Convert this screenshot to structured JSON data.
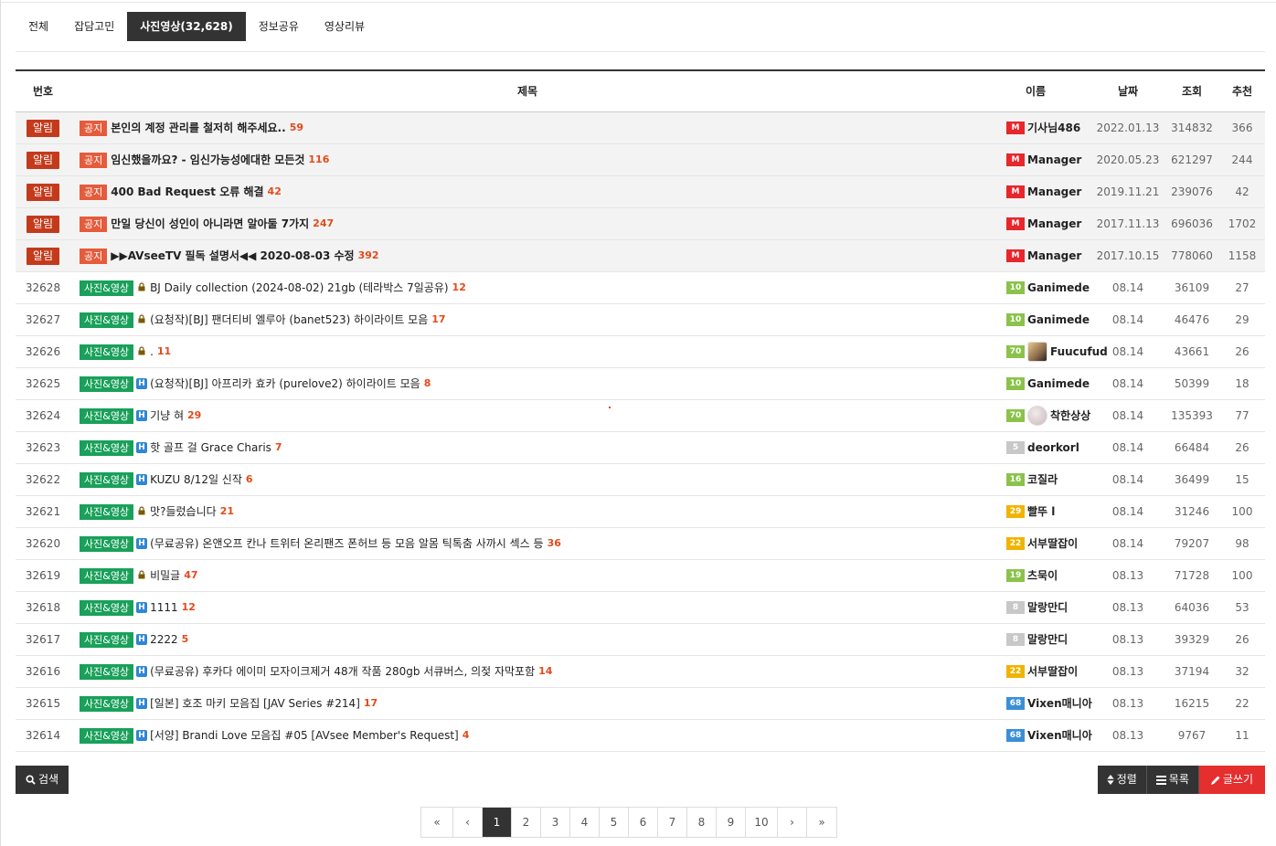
{
  "tabs": [
    {
      "label": "전체",
      "active": false
    },
    {
      "label": "잡담고민",
      "active": false
    },
    {
      "label": "사진영상(32,628)",
      "active": true
    },
    {
      "label": "정보공유",
      "active": false
    },
    {
      "label": "영상리뷰",
      "active": false
    }
  ],
  "headers": {
    "num": "번호",
    "subject": "제목",
    "name": "이름",
    "date": "날짜",
    "views": "조회",
    "rec": "추천"
  },
  "notices": [
    {
      "badge": "알림",
      "cat": "공지",
      "title": "본인의 계정 관리를 철저히 해주세요..",
      "comments": "59",
      "level": "M",
      "name": "기사님486",
      "date": "2022.01.13",
      "views": "314832",
      "rec": "366"
    },
    {
      "badge": "알림",
      "cat": "공지",
      "title": "임신했을까요? - 임신가능성에대한 모든것",
      "comments": "116",
      "level": "M",
      "name": "Manager",
      "date": "2020.05.23",
      "views": "621297",
      "rec": "244"
    },
    {
      "badge": "알림",
      "cat": "공지",
      "title": "400 Bad Request 오류 해결",
      "comments": "42",
      "level": "M",
      "name": "Manager",
      "date": "2019.11.21",
      "views": "239076",
      "rec": "42"
    },
    {
      "badge": "알림",
      "cat": "공지",
      "title": "만일 당신이 성인이 아니라면 알아둘 7가지",
      "comments": "247",
      "level": "M",
      "name": "Manager",
      "date": "2017.11.13",
      "views": "696036",
      "rec": "1702"
    },
    {
      "badge": "알림",
      "cat": "공지",
      "title": "▶▶AVseeTV 필독 설명서◀◀ 2020-08-03 수정",
      "comments": "392",
      "level": "M",
      "name": "Manager",
      "date": "2017.10.15",
      "views": "778060",
      "rec": "1158"
    }
  ],
  "posts": [
    {
      "num": "32628",
      "cat": "사진&영상",
      "icon": "lock",
      "title": "BJ Daily collection (2024-08-02) 21gb (테라박스 7일공유)",
      "comments": "12",
      "level": "10",
      "lvcolor": "#8bc34a",
      "avatar": "",
      "name": "Ganimede",
      "date": "08.14",
      "views": "36109",
      "rec": "27"
    },
    {
      "num": "32627",
      "cat": "사진&영상",
      "icon": "lock",
      "title": "(요청작)[BJ] 팬더티비 엘루아 (banet523) 하이라이트 모음",
      "comments": "17",
      "level": "10",
      "lvcolor": "#8bc34a",
      "avatar": "",
      "name": "Ganimede",
      "date": "08.14",
      "views": "46476",
      "rec": "29"
    },
    {
      "num": "32626",
      "cat": "사진&영상",
      "icon": "lock",
      "title": ".",
      "comments": "11",
      "level": "70",
      "lvcolor": "#8bc34a",
      "avatar": "blonde",
      "name": "Fuucufud",
      "date": "08.14",
      "views": "43661",
      "rec": "26"
    },
    {
      "num": "32625",
      "cat": "사진&영상",
      "icon": "hot",
      "title": "(요청작)[BJ] 아프리카 효카 (purelove2) 하이라이트 모음",
      "comments": "8",
      "level": "10",
      "lvcolor": "#8bc34a",
      "avatar": "",
      "name": "Ganimede",
      "date": "08.14",
      "views": "50399",
      "rec": "18"
    },
    {
      "num": "32624",
      "cat": "사진&영상",
      "icon": "hot",
      "title": "기냥 혀",
      "comments": "29",
      "level": "70",
      "lvcolor": "#8bc34a",
      "avatar": "round",
      "name": "착한상상",
      "date": "08.14",
      "views": "135393",
      "rec": "77"
    },
    {
      "num": "32623",
      "cat": "사진&영상",
      "icon": "hot",
      "title": "핫 골프 걸 Grace Charis",
      "comments": "7",
      "level": "5",
      "lvcolor": "#c8c8c8",
      "avatar": "",
      "name": "deorkorl",
      "date": "08.14",
      "views": "66484",
      "rec": "26"
    },
    {
      "num": "32622",
      "cat": "사진&영상",
      "icon": "hot",
      "title": "KUZU 8/12일 신작",
      "comments": "6",
      "level": "16",
      "lvcolor": "#8bc34a",
      "avatar": "",
      "name": "코질라",
      "date": "08.14",
      "views": "36499",
      "rec": "15"
    },
    {
      "num": "32621",
      "cat": "사진&영상",
      "icon": "lock",
      "title": "맛?들렀습니다",
      "comments": "21",
      "level": "29",
      "lvcolor": "#f0b400",
      "avatar": "",
      "name": "빨뚜 l",
      "date": "08.14",
      "views": "31246",
      "rec": "100"
    },
    {
      "num": "32620",
      "cat": "사진&영상",
      "icon": "hot",
      "title": "(무료공유) 온앤오프 칸나 트위터 온리팬즈 폰허브 등 모음 알몸 틱톡춤 사까시 섹스 등",
      "comments": "36",
      "level": "22",
      "lvcolor": "#f0b400",
      "avatar": "",
      "name": "서부딸잡이",
      "date": "08.14",
      "views": "79207",
      "rec": "98"
    },
    {
      "num": "32619",
      "cat": "사진&영상",
      "icon": "lock",
      "title": "비밀글",
      "comments": "47",
      "level": "19",
      "lvcolor": "#8bc34a",
      "avatar": "",
      "name": "츠묵이",
      "date": "08.13",
      "views": "71728",
      "rec": "100"
    },
    {
      "num": "32618",
      "cat": "사진&영상",
      "icon": "hot",
      "title": "1111",
      "comments": "12",
      "level": "8",
      "lvcolor": "#c8c8c8",
      "avatar": "",
      "name": "말랑만디",
      "date": "08.13",
      "views": "64036",
      "rec": "53"
    },
    {
      "num": "32617",
      "cat": "사진&영상",
      "icon": "hot",
      "title": "2222",
      "comments": "5",
      "level": "8",
      "lvcolor": "#c8c8c8",
      "avatar": "",
      "name": "말랑만디",
      "date": "08.13",
      "views": "39329",
      "rec": "26"
    },
    {
      "num": "32616",
      "cat": "사진&영상",
      "icon": "hot",
      "title": "(무료공유) 후카다 에이미 모자이크제거 48개 작품 280gb 서큐버스, 의젖 자막포함",
      "comments": "14",
      "level": "22",
      "lvcolor": "#f0b400",
      "avatar": "",
      "name": "서부딸잡이",
      "date": "08.13",
      "views": "37194",
      "rec": "32"
    },
    {
      "num": "32615",
      "cat": "사진&영상",
      "icon": "hot",
      "title": "[일본] 호조 마키 모음집 [JAV Series #214]",
      "comments": "17",
      "level": "68",
      "lvcolor": "#3a8fd6",
      "avatar": "",
      "name": "Vixen매니아",
      "date": "08.13",
      "views": "16215",
      "rec": "22"
    },
    {
      "num": "32614",
      "cat": "사진&영상",
      "icon": "hot",
      "title": "[서양] Brandi Love 모음집 #05 [AVsee Member's Request]",
      "comments": "4",
      "level": "68",
      "lvcolor": "#3a8fd6",
      "avatar": "",
      "name": "Vixen매니아",
      "date": "08.13",
      "views": "9767",
      "rec": "11"
    }
  ],
  "buttons": {
    "search": "검색",
    "sort": "정렬",
    "list": "목록",
    "write": "글쓰기"
  },
  "pagination": {
    "first": "«",
    "prev": "‹",
    "pages": [
      "1",
      "2",
      "3",
      "4",
      "5",
      "6",
      "7",
      "8",
      "9",
      "10"
    ],
    "current": "1",
    "next": "›",
    "last": "»"
  },
  "icons": {
    "lock": "lock-icon",
    "hot": "hot-h-icon",
    "search": "search-icon",
    "sort": "sort-icon",
    "list": "list-icon",
    "write": "pencil-icon"
  },
  "colors": {
    "alert": "#c43a1c",
    "notice_cat": "#e45c3c",
    "photo_cat": "#1aa05a",
    "comment": "#e54a1a",
    "dark": "#333333",
    "write": "#e52e2e"
  }
}
